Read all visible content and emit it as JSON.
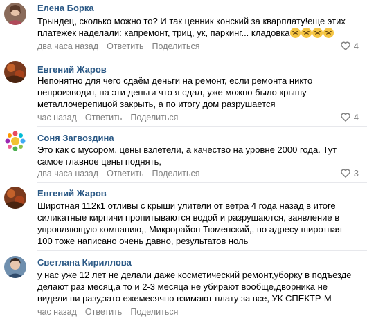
{
  "comments": [
    {
      "author": "Елена Борка",
      "lines": [
        "Трындец, сколько можно то? И так ценник конский за кварплату!еще этих",
        "платежек наделали: капремонт, триц, ук, паркинг... кладовка"
      ],
      "emoji": [
        "persevering-face-emoji",
        "persevering-face-emoji",
        "persevering-face-emoji",
        "persevering-face-emoji"
      ],
      "time": "два часа назад",
      "reply": "Ответить",
      "share": "Поделиться",
      "likes": "4"
    },
    {
      "author": "Евгений Жаров",
      "lines": [
        "Непонятно для чего сдаём деньги на ремонт, если ремонта никто",
        "непроизводит, на эти деньги что я сдал, уже можно было крышу",
        "металлочерепицой закрыть, а по итогу дом разрушается"
      ],
      "time": "час назад",
      "reply": "Ответить",
      "share": "Поделиться",
      "likes": "4"
    },
    {
      "author": "Соня Загвоздина",
      "lines": [
        "Это как с мусором, цены взлетели, а качество на уровне 2000 года. Тут",
        "самое главное цены поднять,"
      ],
      "time": "два часа назад",
      "reply": "Ответить",
      "share": "Поделиться",
      "likes": "3"
    },
    {
      "author": "Евгений Жаров",
      "lines": [
        "Широтная 112к1 отливы с крыши улители от ветра 4 года назад в итоге",
        "силикатные кирпичи пропитываются водой и разрушаются, заявление в",
        "упровляющую компанию,, Микрорайон Тюменский,, по адресу широтная",
        "100 тоже написано очень давно, результатов ноль"
      ],
      "time": "час назад",
      "reply": "Ответить",
      "share": "Поделиться",
      "likes": ""
    },
    {
      "author": "Светлана Кириллова",
      "lines": [
        "у нас уже 12 лет не делали даже косметический ремонт,уборку в подъезде",
        "делают раз месяц,а то и 2-3 месяца не убирают вообще,дворника не",
        "видели ни разу,зато ежемесячно взимают плату за все, УК СПЕКТР-М"
      ],
      "time": "час назад",
      "reply": "Ответить",
      "share": "Поделиться",
      "likes": ""
    }
  ],
  "colors": {
    "author": "#2a5885",
    "meta": "#828282",
    "divider": "#e7e8ec"
  }
}
